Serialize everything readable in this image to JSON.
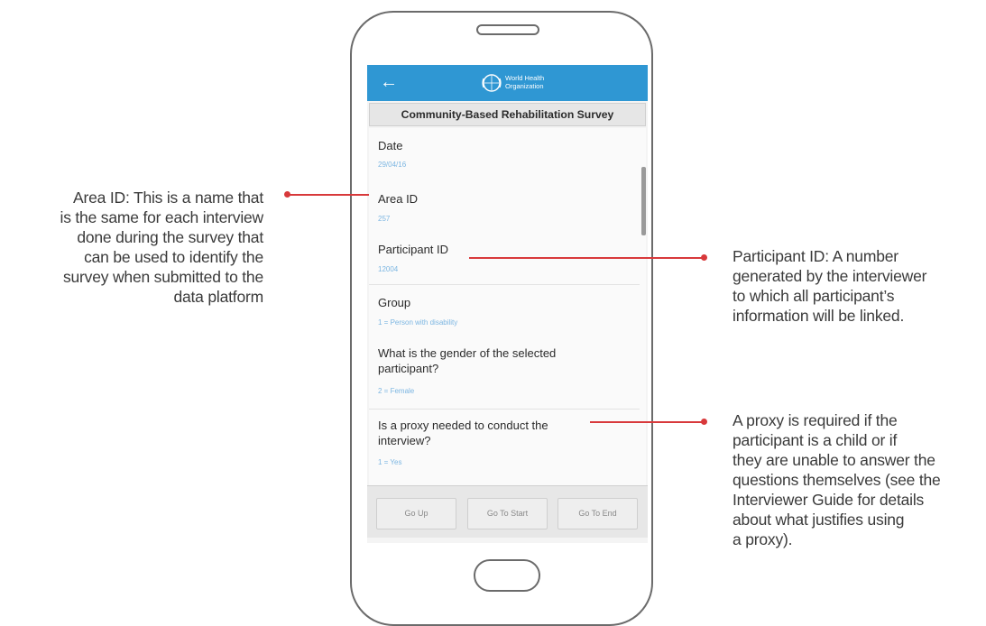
{
  "callouts": {
    "area_id": [
      "Area ID: This is a name that",
      "is the same for each interview",
      "done during the survey that",
      "can be used to identify the",
      "survey when submitted to the",
      "data platform"
    ],
    "participant_id": [
      "Participant ID: A number",
      "generated by the interviewer",
      "to which all participant’s",
      "information will be linked."
    ],
    "proxy": [
      "A proxy is required if the",
      "participant is a child or if",
      "they are unable to answer the",
      "questions themselves (see the",
      "Interviewer Guide for details",
      "about what justifies using",
      "a proxy)."
    ]
  },
  "app": {
    "back_icon": "←",
    "logo_text": [
      "World Health",
      "Organization"
    ],
    "survey_title": "Community-Based Rehabilitation Survey"
  },
  "fields": [
    {
      "question": [
        "Date"
      ],
      "answer": "29/04/16"
    },
    {
      "question": [
        "Area ID"
      ],
      "answer": "257"
    },
    {
      "question": [
        "Participant ID"
      ],
      "answer": "12004"
    },
    {
      "question": [
        "Group"
      ],
      "answer": "1 = Person with disability"
    },
    {
      "question": [
        "What is the gender of the selected",
        "participant?"
      ],
      "answer": "2 = Female"
    },
    {
      "question": [
        "Is a proxy needed to conduct the",
        "interview?"
      ],
      "answer": "1 = Yes"
    }
  ],
  "buttons": {
    "go_up": "Go Up",
    "go_to_start": "Go To Start",
    "go_to_end": "Go To End"
  },
  "colors": {
    "app_bar": "#2f97d3",
    "callout_line": "#d8393b",
    "answer_text": "#7cb6e2"
  }
}
